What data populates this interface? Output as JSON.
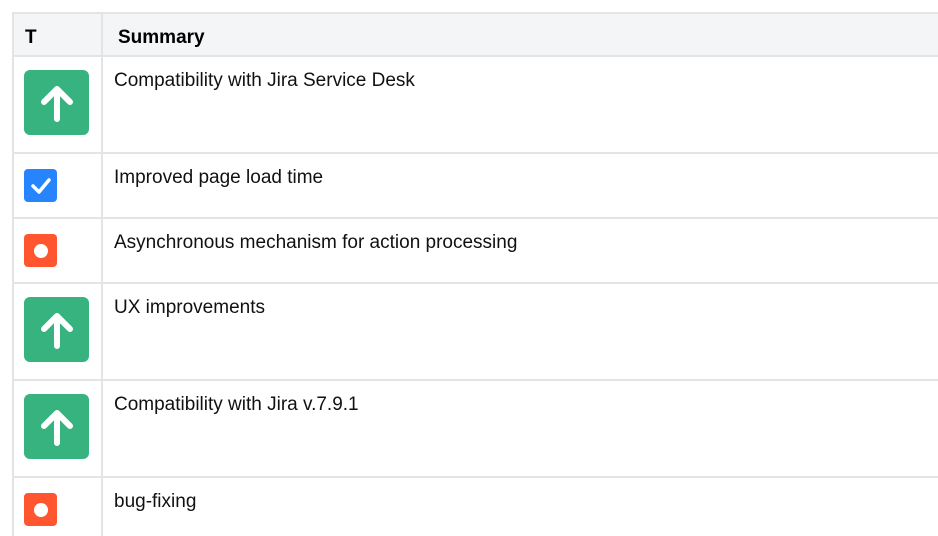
{
  "table": {
    "headers": {
      "type": "T",
      "summary": "Summary"
    },
    "rows": [
      {
        "type_icon": "improvement-arrow-up-icon",
        "summary": "Compatibility with Jira Service Desk"
      },
      {
        "type_icon": "task-checkmark-icon",
        "summary": "Improved page load time"
      },
      {
        "type_icon": "bug-dot-icon",
        "summary": "Asynchronous mechanism for action processing"
      },
      {
        "type_icon": "improvement-arrow-up-icon",
        "summary": "UX improvements"
      },
      {
        "type_icon": "improvement-arrow-up-icon",
        "summary": "Compatibility with Jira v.7.9.1"
      },
      {
        "type_icon": "bug-dot-icon",
        "summary": "bug-fixing"
      }
    ]
  },
  "colors": {
    "improvement": "#36b37e",
    "task": "#2684ff",
    "bug": "#ff5630",
    "border": "#e3e4e6",
    "header_bg": "#f4f5f7"
  }
}
